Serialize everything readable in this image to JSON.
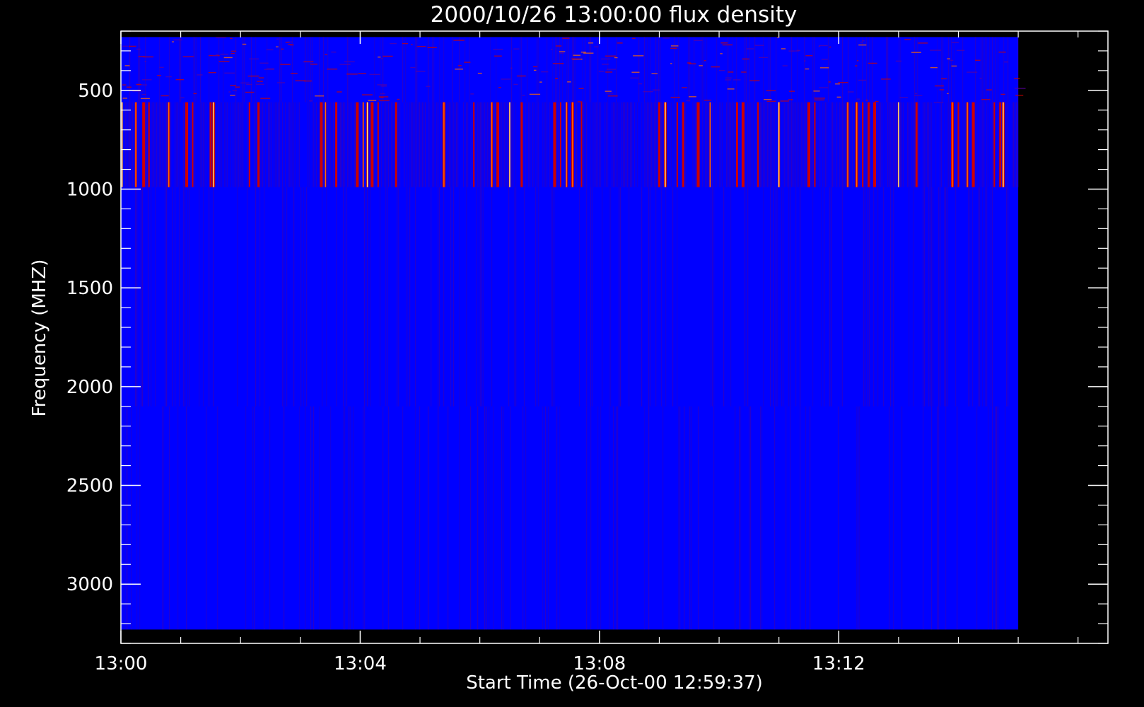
{
  "chart_data": {
    "type": "heatmap",
    "title": "2000/10/26 13:00:00 flux density",
    "xlabel": "Start Time (26-Oct-00 12:59:37)",
    "ylabel": "Frequency (MHZ)",
    "xlim_min": [
      0,
      16.5
    ],
    "ylim_mhz": [
      3300,
      200
    ],
    "data_extent": {
      "time_min": [
        0,
        15
      ],
      "freq_mhz": [
        3230,
        230
      ]
    },
    "x_ticks": [
      {
        "value_min": 0,
        "label": "13:00"
      },
      {
        "value_min": 4,
        "label": "13:04"
      },
      {
        "value_min": 8,
        "label": "13:08"
      },
      {
        "value_min": 12,
        "label": "13:12"
      }
    ],
    "x_minor_step_min": 1,
    "y_ticks": [
      {
        "value": 500,
        "label": "500"
      },
      {
        "value": 1000,
        "label": "1000"
      },
      {
        "value": 1500,
        "label": "1500"
      },
      {
        "value": 2000,
        "label": "2000"
      },
      {
        "value": 2500,
        "label": "2500"
      },
      {
        "value": 3000,
        "label": "3000"
      }
    ],
    "y_minor_step": 100,
    "y_reversed": true,
    "bands": [
      {
        "freq_top": 230,
        "freq_bottom": 560,
        "pattern": "noise",
        "intensity": 0.08
      },
      {
        "freq_top": 560,
        "freq_bottom": 990,
        "pattern": "burst-stripes",
        "intensity": 0.25
      },
      {
        "freq_top": 990,
        "freq_bottom": 2100,
        "pattern": "fine-stripes",
        "intensity": 0.07
      },
      {
        "freq_top": 2100,
        "freq_bottom": 3230,
        "pattern": "fine-stripes",
        "intensity": 0.05
      }
    ],
    "burst_times_min": [
      0.02,
      0.25,
      0.38,
      0.47,
      0.8,
      1.1,
      1.2,
      1.5,
      1.55,
      2.15,
      2.3,
      3.35,
      3.42,
      3.6,
      3.95,
      4.05,
      4.12,
      4.2,
      4.3,
      4.6,
      5.4,
      5.9,
      6.2,
      6.3,
      6.5,
      6.7,
      7.25,
      7.35,
      7.45,
      7.55,
      7.7,
      9.0,
      9.1,
      9.3,
      9.4,
      9.65,
      9.85,
      10.3,
      10.4,
      10.65,
      11.0,
      11.5,
      11.6,
      12.15,
      12.3,
      12.4,
      12.5,
      12.6,
      13.0,
      13.3,
      13.9,
      14.0,
      14.15,
      14.25,
      14.6,
      14.7,
      14.75
    ],
    "colors": {
      "background": "#000000",
      "base": "#0000ff",
      "low": "#1a00d8",
      "mid": "#cc0000",
      "high": "#ff6a00",
      "peak": "#ffee88",
      "axis": "#ffffff"
    }
  }
}
